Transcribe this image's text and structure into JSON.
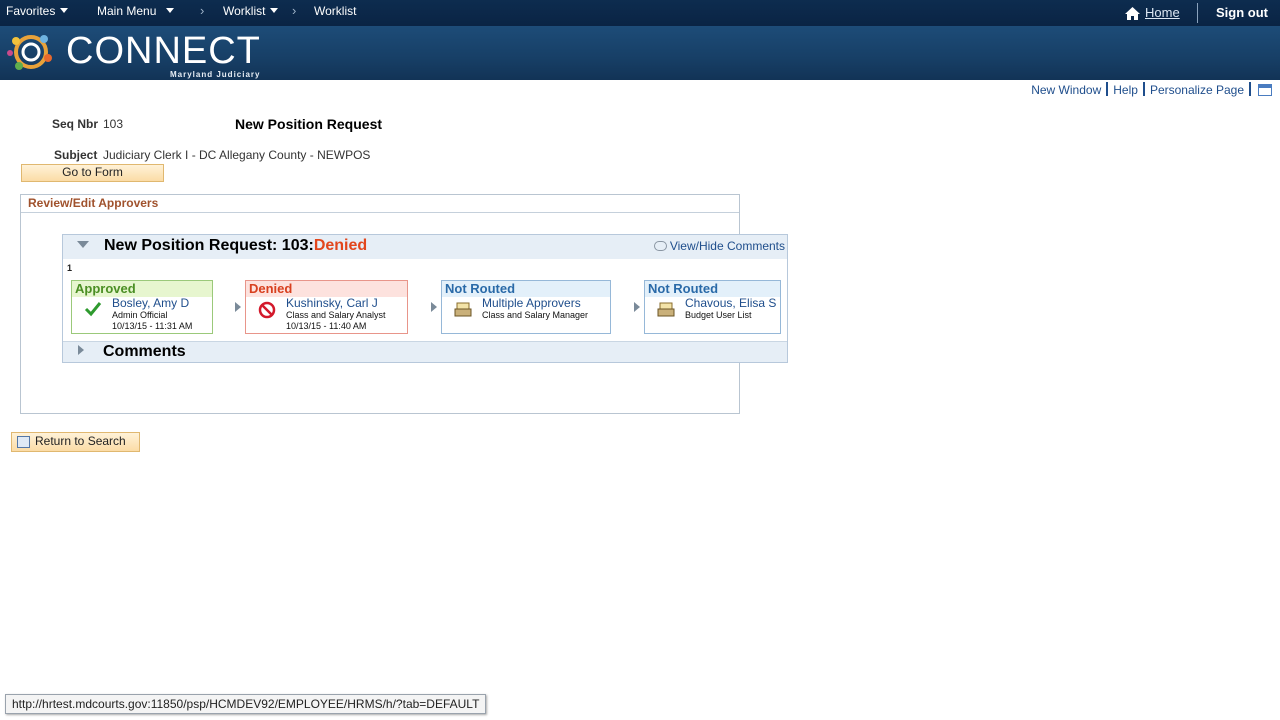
{
  "topnav": {
    "favorites": "Favorites",
    "main_menu": "Main Menu",
    "worklist1": "Worklist",
    "worklist2": "Worklist",
    "home": "Home",
    "sign_out": "Sign out"
  },
  "banner": {
    "logo_text": "CONNECT",
    "logo_sub": "Maryland Judiciary"
  },
  "pagelinks": {
    "new_window": "New Window",
    "help": "Help",
    "personalize": "Personalize Page"
  },
  "form": {
    "seq_label": "Seq Nbr",
    "seq_value": "103",
    "title": "New Position Request",
    "subject_label": "Subject",
    "subject_value": "Judiciary Clerk I - DC Allegany County - NEWPOS",
    "go_to_form": "Go to Form"
  },
  "approvers": {
    "section_title": "Review/Edit Approvers",
    "panel_title": "New Position Request: 103:",
    "panel_status": "Denied",
    "view_hide": "View/Hide Comments",
    "path_number": "1",
    "steps": [
      {
        "status": "Approved",
        "name": "Bosley, Amy D",
        "role": "Admin Official",
        "date": "10/13/15 - 11:31 AM"
      },
      {
        "status": "Denied",
        "name": "Kushinsky, Carl J",
        "role": "Class and Salary Analyst",
        "date": "10/13/15 - 11:40 AM"
      },
      {
        "status": "Not Routed",
        "name": "Multiple Approvers",
        "role": "Class and Salary Manager",
        "date": ""
      },
      {
        "status": "Not Routed",
        "name": "Chavous, Elisa S",
        "role": "Budget User List",
        "date": ""
      }
    ],
    "comments_title": "Comments"
  },
  "return_to_search": "Return to Search",
  "status_url": "http://hrtest.mdcourts.gov:11850/psp/HCMDEV92/EMPLOYEE/HRMS/h/?tab=DEFAULT",
  "colors": {
    "nav_bg": "#0d2c4f",
    "banner_bg": "#1d4c78",
    "approved": "#4b8f24",
    "denied": "#d8401f",
    "not_routed": "#2a6aa8",
    "link": "#1f4e8c"
  }
}
